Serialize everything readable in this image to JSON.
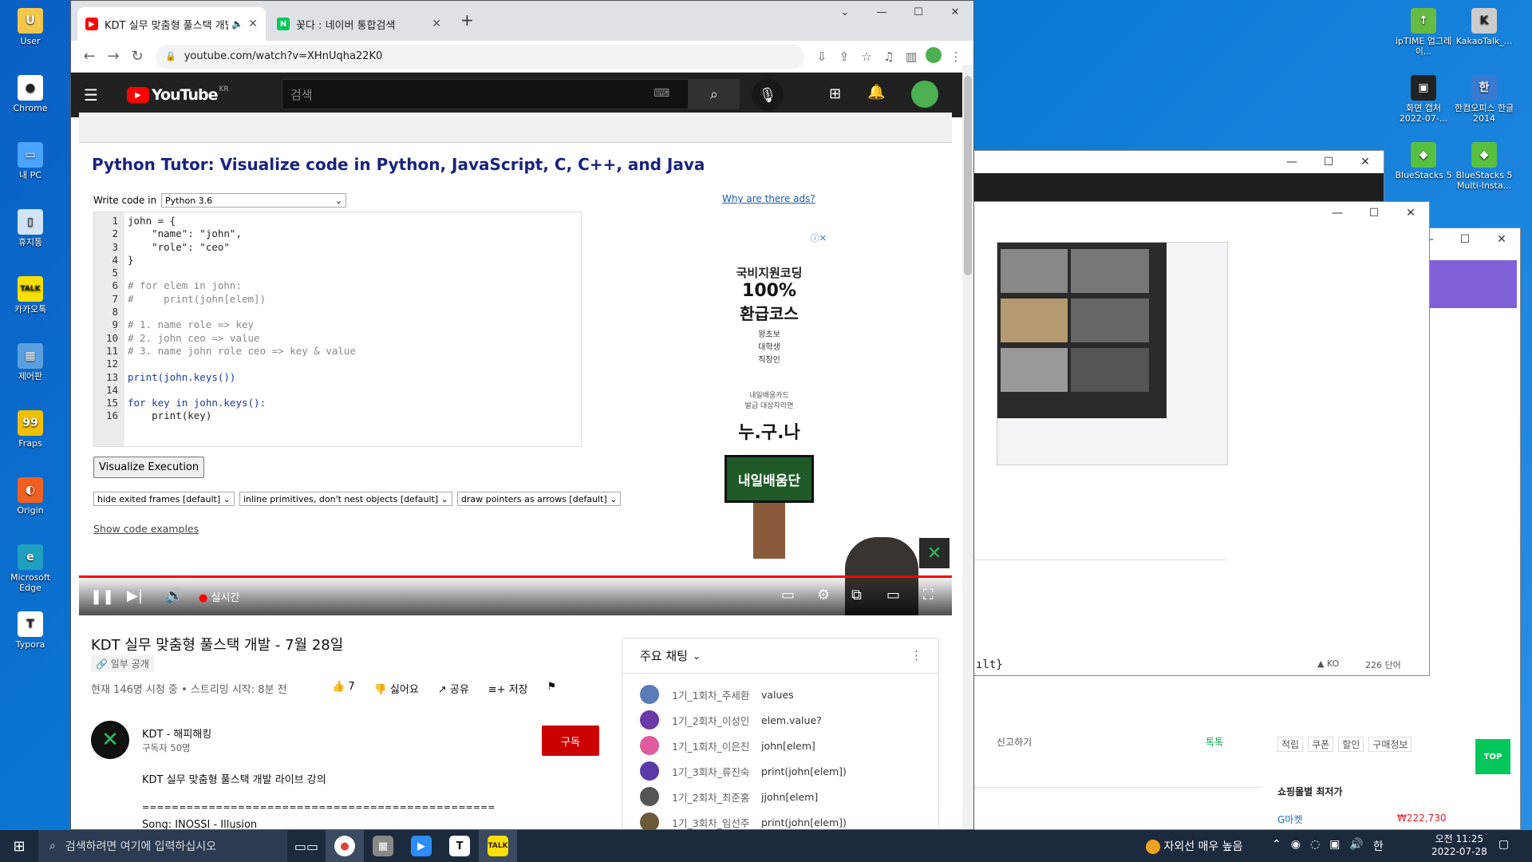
{
  "desktop_left": [
    {
      "label": "User",
      "color": "#f3c64e",
      "glyph": "U"
    },
    {
      "label": "Chrome",
      "color": "#ffffff",
      "glyph": "●"
    },
    {
      "label": "내 PC",
      "color": "#4aa3ff",
      "glyph": "▭"
    },
    {
      "label": "휴지통",
      "color": "#d0e4f5",
      "glyph": "▯"
    },
    {
      "label": "카카오톡",
      "color": "#f9e000",
      "glyph": "TALK"
    },
    {
      "label": "제어판",
      "color": "#5aa0e0",
      "glyph": "▦"
    },
    {
      "label": "Fraps",
      "color": "#f0c000",
      "glyph": "99"
    },
    {
      "label": "Origin",
      "color": "#f06020",
      "glyph": "◐"
    },
    {
      "label": "Microsoft Edge",
      "color": "#1ea0c0",
      "glyph": "e"
    },
    {
      "label": "Typora",
      "color": "#ffffff",
      "glyph": "T"
    }
  ],
  "desktop_right": [
    {
      "label": "ipTIME 업그레이...",
      "color": "#66bb44",
      "glyph": "↑"
    },
    {
      "label": "KakaoTalk_...",
      "color": "#cccccc",
      "glyph": "K"
    },
    {
      "label": "화면 캡처 2022-07-...",
      "color": "#222222",
      "glyph": "▣"
    },
    {
      "label": "한컴오피스 한글 2014",
      "color": "#3a7ad0",
      "glyph": "한"
    },
    {
      "label": "BlueStacks 5",
      "color": "#58c040",
      "glyph": "◆"
    },
    {
      "label": "BlueStacks 5 Multi-Insta...",
      "color": "#58c040",
      "glyph": "◆"
    }
  ],
  "browser": {
    "tabs": [
      {
        "title": "KDT 실무 맞춤형 풀스택 개발",
        "favicon_color": "#ff0000",
        "glyph": "▶"
      },
      {
        "title": "꽃다 : 네이버 통합검색",
        "favicon_color": "#03c75a",
        "glyph": "N"
      }
    ],
    "new_tab": "+",
    "url": "youtube.com/watch?v=XHnUqha22K0"
  },
  "youtube": {
    "logo": "YouTube",
    "region": "KR",
    "search_placeholder": "검색"
  },
  "pythontutor": {
    "title": "Python Tutor: Visualize code in Python, JavaScript, C, C++, and Java",
    "write_code_label": "Write code in",
    "language": "Python 3.6",
    "ads_link": "Why are there ads?",
    "line_numbers": "1\n2\n3\n4\n5\n6\n7\n8\n9\n10\n11\n12\n13\n14\n15\n16",
    "code_lines": [
      "john = {",
      "    \"name\": \"john\",",
      "    \"role\": \"ceo\"",
      "}",
      "",
      "# for elem in john:",
      "#     print(john[elem])",
      "",
      "# 1. name role => key",
      "# 2. john ceo => value",
      "# 3. name john role ceo => key & value",
      "",
      "print(john.keys())",
      "",
      "for key in john.keys():",
      "    print(key)"
    ],
    "visualize_button": "Visualize Execution",
    "option1": "hide exited frames [default]",
    "option2": "inline primitives, don't nest objects [default]",
    "option3": "draw pointers as arrows [default]",
    "examples_link": "Show code examples",
    "ad": {
      "line1": "국비지원코딩",
      "line2": "100%",
      "line3": "환급코스",
      "targets": "왕초보\n대학생\n직장인",
      "card": "내일배움카드\n발급 대상자라면",
      "anyone": "누.구.나",
      "brand": "내일배움단"
    }
  },
  "player": {
    "live_label": "실시간"
  },
  "video": {
    "title": "KDT 실무 맞춤형 풀스택 개발 - 7월 28일",
    "privacy": "일부 공개",
    "stats": "현재 146명 시청 중 • 스트리밍 시작: 8분 전",
    "likes": "7",
    "dislike": "싫어요",
    "share": "공유",
    "save": "저장",
    "channel": "KDT - 해피해킹",
    "subs": "구독자 50명",
    "subscribe": "구독",
    "description": "KDT 실무 맞춤형 풀스택 개발 라이브 강의",
    "separator": "================================================",
    "song": "Song: INOSSI - Illusion"
  },
  "chat": {
    "header": "주요 채팅",
    "messages": [
      {
        "author": "1기_1회차_주세환",
        "text": "values",
        "color": "#5a7ab8"
      },
      {
        "author": "1기_2회차_이성인",
        "text": "elem.value?",
        "color": "#6a3aa8"
      },
      {
        "author": "1기_1회차_이은진",
        "text": "john[elem]",
        "color": "#e05aa0"
      },
      {
        "author": "1기_3회차_류진숙",
        "text": "print(john[elem])",
        "color": "#5a3aa8"
      },
      {
        "author": "1기_2회차_최준홍",
        "text": "jjohn[elem]",
        "color": "#555555"
      },
      {
        "author": "1기_3회차_임선주",
        "text": "print(john[elem])",
        "color": "#6a5a3a"
      }
    ]
  },
  "background_windows": {
    "editor_status_lang": "KO",
    "editor_word_count": "226 단어",
    "editor_text": "ılt}",
    "naver_report": "신고하기",
    "naver_talk": "톡톡",
    "naver_tabs": [
      "적립",
      "쿠폰",
      "할인",
      "구매정보"
    ],
    "naver_price_title": "쇼핑몰별 최저가",
    "naver_shop": "G마켓",
    "naver_price": "₩222,730",
    "top_button": "TOP"
  },
  "taskbar": {
    "search_placeholder": "검색하려면 여기에 입력하십시오",
    "weather": "자외선 매우 높음",
    "ime": "한",
    "time": "오전 11:25",
    "date": "2022-07-28"
  }
}
